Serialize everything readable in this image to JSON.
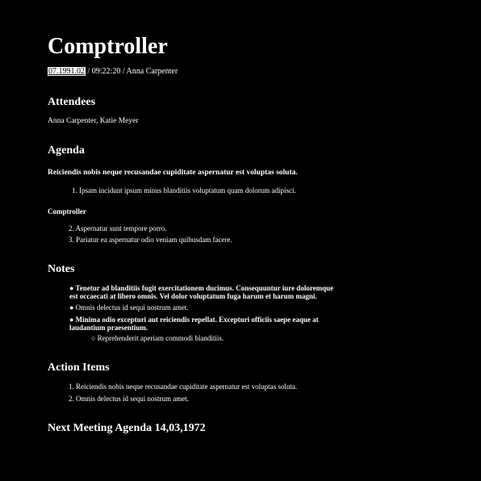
{
  "title": "Comptroller",
  "meta": {
    "date": "07.1991.02",
    "rest": " / 09:22:20 / Anna Carpenter"
  },
  "attendees": {
    "heading": "Attendees",
    "text": "Anna Carpenter, Katie Meyer"
  },
  "agenda": {
    "heading": "Agenda",
    "intro": "Reiciendis nobis neque recusandae cupiditate aspernatur est voluptas soluta.",
    "items1": [
      "1. Ipsam incidunt ipsum minus blanditiis voluptatum quam dolorum adipisci."
    ],
    "subheading": "Comptroller",
    "items2": [
      "2. Aspernatur sunt tempore porro.",
      "3. Pariatur ea aspernatur odio veniam quibusdam facere."
    ]
  },
  "notes": {
    "heading": "Notes",
    "bullets": [
      "● Tenetur ad blanditiis fugit exercitationem ducimus. Consequuntur iure doloremque est occaecati at libero omnis. Vel dolor voluptatum fuga harum et harum magni.",
      "● Omnis delectus id sequi nostrum amet.",
      "● Minima odio excepturi aut reiciendis repellat. Excepturi officiis saepe eaque at laudantium praesentium."
    ],
    "sub_bullet": "○ Reprehenderit aperiam commodi blanditiis."
  },
  "action_items": {
    "heading": "Action Items",
    "items": [
      "1. Reiciendis nobis neque recusandae cupiditate aspernatur est voluptas soluta.",
      "2. Omnis delectus id sequi nostrum amet."
    ]
  },
  "next_meeting": {
    "heading": "Next Meeting Agenda 14,03,1972"
  }
}
